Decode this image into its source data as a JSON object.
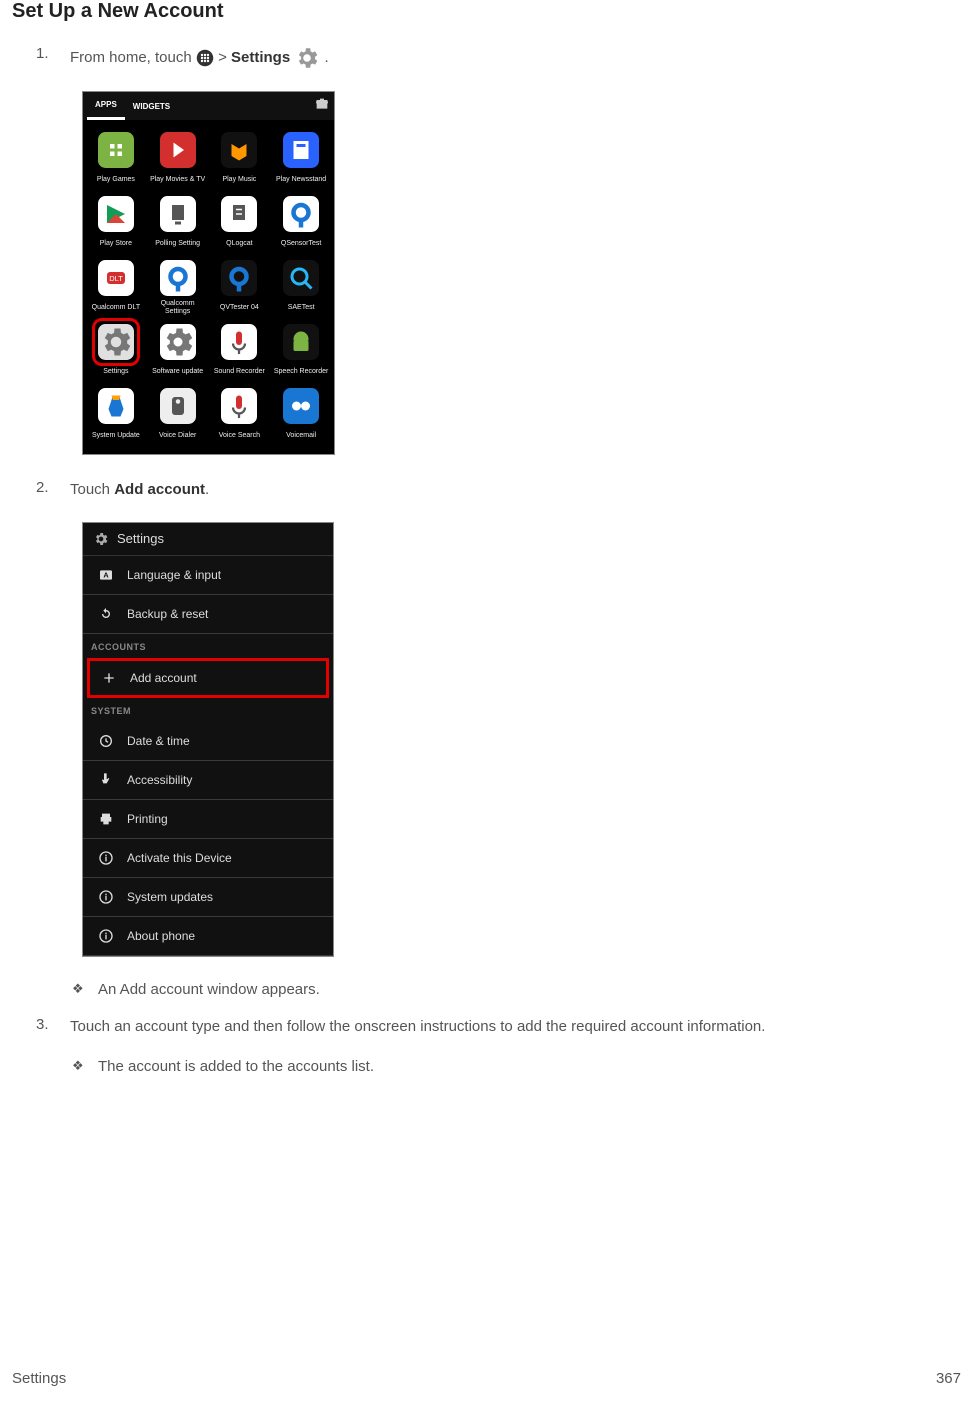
{
  "title": "Set Up a New Account",
  "steps": {
    "s1": {
      "num": "1.",
      "prefix": "From home, touch ",
      "mid": " > ",
      "bold": "Settings",
      "suffix": " ."
    },
    "s2": {
      "num": "2.",
      "prefix": "Touch ",
      "bold": "Add account",
      "suffix": "."
    },
    "s3": {
      "num": "3.",
      "text": "Touch an account type and then follow the onscreen instructions to add the required account information."
    }
  },
  "notes": {
    "n1": "An Add account window appears.",
    "n2": "The account is added to the accounts list."
  },
  "shot1": {
    "tabs": {
      "apps": "APPS",
      "widgets": "WIDGETS"
    },
    "apps": [
      {
        "label": "Play Games"
      },
      {
        "label": "Play Movies & TV"
      },
      {
        "label": "Play Music"
      },
      {
        "label": "Play Newsstand"
      },
      {
        "label": "Play Store"
      },
      {
        "label": "Polling Setting"
      },
      {
        "label": "QLogcat"
      },
      {
        "label": "QSensorTest"
      },
      {
        "label": "Qualcomm DLT"
      },
      {
        "label": "Qualcomm Settings"
      },
      {
        "label": "QVTester 04"
      },
      {
        "label": "SAETest"
      },
      {
        "label": "Settings"
      },
      {
        "label": "Software update"
      },
      {
        "label": "Sound Recorder"
      },
      {
        "label": "Speech Recorder"
      },
      {
        "label": "System Update"
      },
      {
        "label": "Voice Dialer"
      },
      {
        "label": "Voice Search"
      },
      {
        "label": "Voicemail"
      }
    ]
  },
  "shot2": {
    "header": "Settings",
    "rows": {
      "r1": "Language & input",
      "r2": "Backup & reset",
      "cat1": "ACCOUNTS",
      "r3": "Add account",
      "cat2": "SYSTEM",
      "r4": "Date & time",
      "r5": "Accessibility",
      "r6": "Printing",
      "r7": "Activate this Device",
      "r8": "System updates",
      "r9": "About phone"
    }
  },
  "footer": {
    "left": "Settings",
    "right": "367"
  }
}
